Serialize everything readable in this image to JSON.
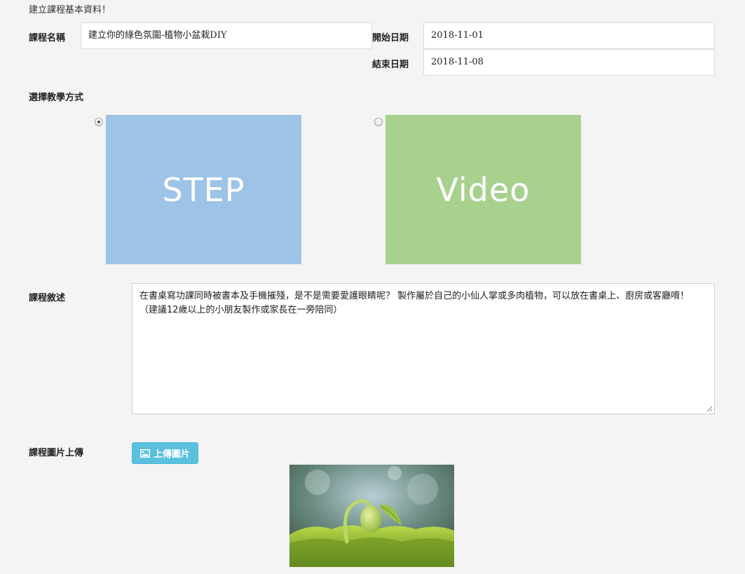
{
  "intro": "建立課程基本資料！",
  "course_name": {
    "label": "課程名稱",
    "value": "建立你的綠色氛圍-植物小盆栽DIY"
  },
  "start_date": {
    "label": "開始日期",
    "value": "2018-11-01"
  },
  "end_date": {
    "label": "結束日期",
    "value": "2018-11-08"
  },
  "teaching_mode": {
    "label": "選擇教學方式",
    "options": [
      {
        "label": "STEP",
        "checked": true,
        "color": "#9dc3e6"
      },
      {
        "label": "Video",
        "checked": false,
        "color": "#a9d18e"
      }
    ]
  },
  "description": {
    "label": "課程敘述",
    "text": "在書桌寫功課同時被書本及手機摧殘，是不是需要愛護眼睛呢？ 製作屬於自己的小仙人掌或多肉植物，可以放在書桌上、廚房或客廳唷！（建議12歲以上的小朋友製作或家長在一旁陪同）"
  },
  "image_upload": {
    "label": "課程圖片上傳",
    "button_label": "上傳圖片"
  }
}
